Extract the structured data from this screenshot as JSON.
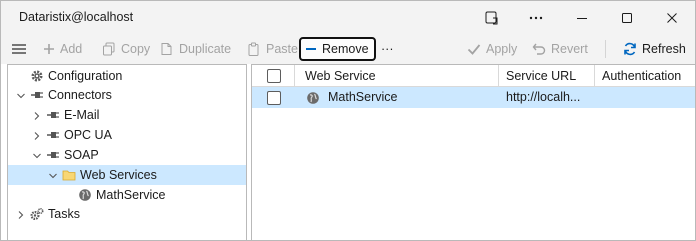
{
  "window": {
    "title": "Dataristix@localhost"
  },
  "toolbar": {
    "add": "Add",
    "copy": "Copy",
    "duplicate": "Duplicate",
    "paste": "Paste",
    "remove": "Remove",
    "more": "···",
    "apply": "Apply",
    "revert": "Revert",
    "refresh": "Refresh"
  },
  "tree": {
    "items": [
      {
        "label": "Configuration"
      },
      {
        "label": "Connectors"
      },
      {
        "label": "E-Mail"
      },
      {
        "label": "OPC UA"
      },
      {
        "label": "SOAP"
      },
      {
        "label": "Web Services"
      },
      {
        "label": "MathService"
      },
      {
        "label": "Tasks"
      }
    ]
  },
  "grid": {
    "columns": [
      "Web Service",
      "Service URL",
      "Authentication"
    ],
    "rows": [
      {
        "web_service": "MathService",
        "service_url": "http://localh...",
        "authentication": ""
      }
    ]
  },
  "colors": {
    "selection": "#cce8ff",
    "accent": "#0067c0"
  },
  "icons": {
    "titlebar": [
      "snap-icon",
      "more-icon",
      "minimize-icon",
      "maximize-icon",
      "close-icon"
    ],
    "tree": [
      "gear-icon",
      "connector-icon",
      "folder-icon",
      "globe-icon"
    ]
  }
}
